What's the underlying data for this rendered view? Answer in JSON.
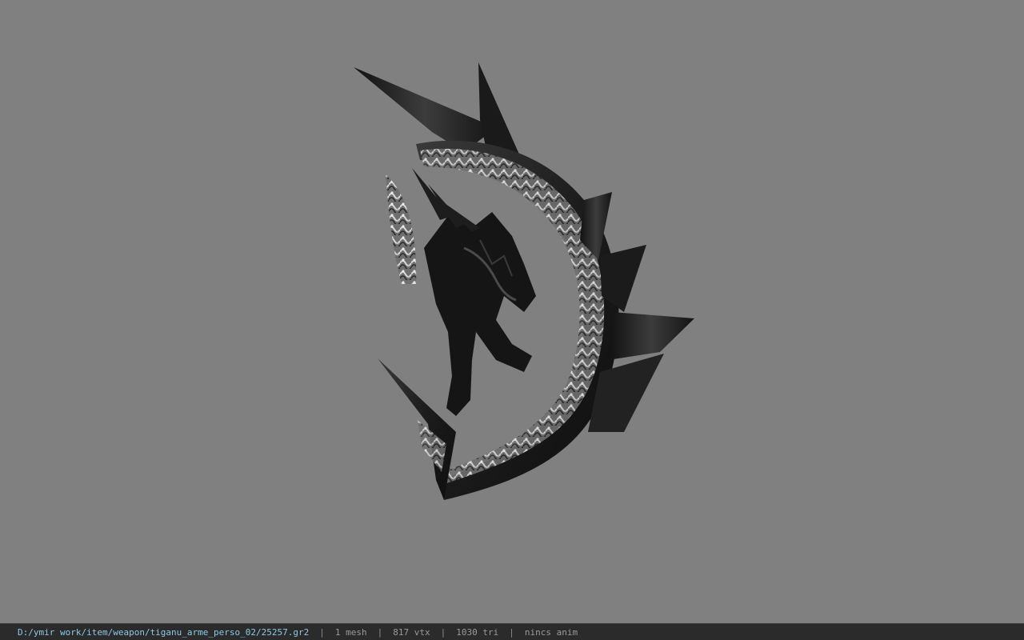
{
  "viewer": {
    "background_color": "#808080",
    "model": {
      "icon": "dragon-scythe-weapon-model"
    }
  },
  "status": {
    "file_path": "D:/ymir work/item/weapon/tiganu_arme_perso_02/25257.gr2",
    "separator": "|",
    "mesh_count": "1 mesh",
    "vertex_count": "817 vtx",
    "triangle_count": "1030 tri",
    "animation": "nincs anim"
  }
}
